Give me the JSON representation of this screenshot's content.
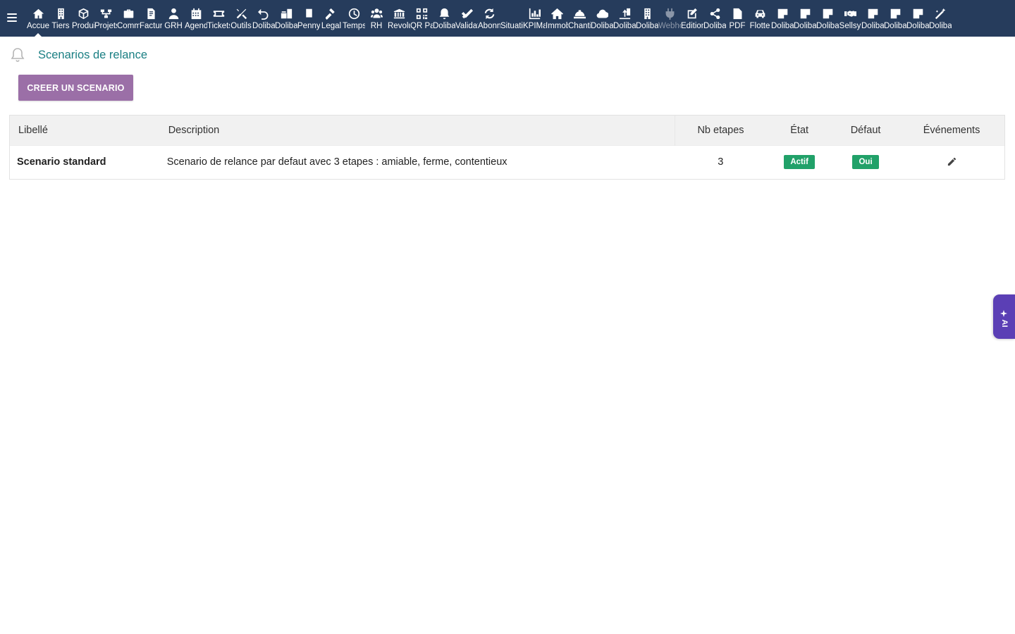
{
  "menu": [
    {
      "label": "Accueil",
      "icon": "home-icon"
    },
    {
      "label": "Tiers",
      "icon": "building-icon"
    },
    {
      "label": "Produits",
      "icon": "cube-icon"
    },
    {
      "label": "Projets",
      "icon": "sitemap-icon"
    },
    {
      "label": "Commercial",
      "icon": "suitcase-icon"
    },
    {
      "label": "Facturation",
      "icon": "invoice-icon"
    },
    {
      "label": "GRH",
      "icon": "user-tie-icon"
    },
    {
      "label": "Agenda",
      "icon": "calendar-icon"
    },
    {
      "label": "Tickets",
      "icon": "ticket-icon"
    },
    {
      "label": "Outils",
      "icon": "tools-icon"
    },
    {
      "label": "Dolibarr",
      "icon": "undo-icon"
    },
    {
      "label": "Dolibarr",
      "icon": "briefcase-icon"
    },
    {
      "label": "Penny",
      "icon": "document-icon"
    },
    {
      "label": "Legal",
      "icon": "gavel-icon"
    },
    {
      "label": "Temps",
      "icon": "clock-icon"
    },
    {
      "label": "RH",
      "icon": "users-icon"
    },
    {
      "label": "Revolut",
      "icon": "bank-icon"
    },
    {
      "label": "QR Payment",
      "icon": "qrcode-icon"
    },
    {
      "label": "Dolibarr",
      "icon": "bell-icon"
    },
    {
      "label": "Validation",
      "icon": "check-double-icon"
    },
    {
      "label": "Abonnements",
      "icon": "sync-icon"
    },
    {
      "label": "Situations",
      "icon": "blank-icon"
    },
    {
      "label": "KPIManager",
      "icon": "chart-bar-icon"
    },
    {
      "label": "Immobilier",
      "icon": "house-icon"
    },
    {
      "label": "Chantiers",
      "icon": "helmet-icon"
    },
    {
      "label": "Dolibarr",
      "icon": "cloud-icon"
    },
    {
      "label": "Dolibarr",
      "icon": "upload-icon"
    },
    {
      "label": "Dolibarr",
      "icon": "building-icon"
    },
    {
      "label": "Webhooks",
      "icon": "plug-icon",
      "dim": true
    },
    {
      "label": "Edition",
      "icon": "edit-icon"
    },
    {
      "label": "Dolibarr",
      "icon": "share-icon"
    },
    {
      "label": "PDF",
      "icon": "file-pdf-icon"
    },
    {
      "label": "Flotte",
      "icon": "car-icon"
    },
    {
      "label": "Dolibarr",
      "icon": "note-icon"
    },
    {
      "label": "Dolibarr",
      "icon": "note-icon"
    },
    {
      "label": "Dolibarr",
      "icon": "note-icon"
    },
    {
      "label": "Sellsy",
      "icon": "handshake-icon"
    },
    {
      "label": "Dolibarr",
      "icon": "note-icon"
    },
    {
      "label": "Dolibarr",
      "icon": "note-icon"
    },
    {
      "label": "Dolibarr",
      "icon": "note-icon"
    },
    {
      "label": "Dolibarr",
      "icon": "magic-icon"
    }
  ],
  "page": {
    "title": "Scenarios de relance",
    "create_button": "CREER UN SCENARIO"
  },
  "table": {
    "headers": {
      "libelle": "Libellé",
      "description": "Description",
      "nb_etapes": "Nb etapes",
      "etat": "État",
      "defaut": "Défaut",
      "evenements": "Événements"
    },
    "rows": [
      {
        "libelle": "Scenario standard",
        "description": "Scenario de relance par defaut avec 3 etapes : amiable, ferme, contentieux",
        "nb_etapes": "3",
        "etat": "Actif",
        "defaut": "Oui"
      }
    ]
  },
  "ai_tab": {
    "label": "AI"
  },
  "colors": {
    "topbar": "#263c5c",
    "accent_title": "#1a7f83",
    "create_button": "#9b6fa7",
    "badge_green": "#21a169",
    "ai_tab": "#5b3fb5"
  }
}
